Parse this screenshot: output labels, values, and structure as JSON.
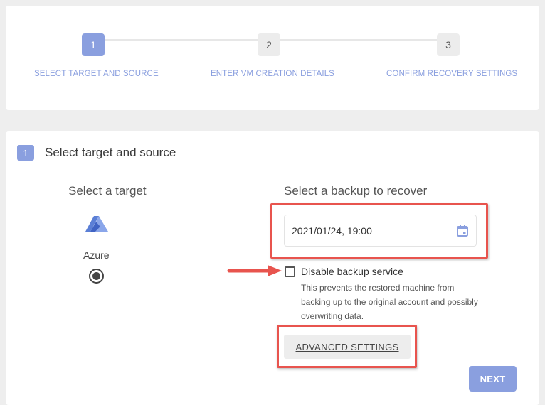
{
  "stepper": {
    "steps": [
      {
        "number": "1",
        "label": "SELECT TARGET AND SOURCE",
        "state": "active"
      },
      {
        "number": "2",
        "label": "ENTER VM CREATION DETAILS",
        "state": "inactive"
      },
      {
        "number": "3",
        "label": "CONFIRM RECOVERY SETTINGS",
        "state": "inactive"
      }
    ]
  },
  "section": {
    "number": "1",
    "title": "Select target and source"
  },
  "target": {
    "heading": "Select a target",
    "option_label": "Azure",
    "icon": "azure-logo-icon",
    "selected": true
  },
  "backup": {
    "heading": "Select a backup to recover",
    "date_value": "2021/01/24, 19:00",
    "icon": "calendar-icon"
  },
  "disable_backup": {
    "label": "Disable backup service",
    "description": "This prevents the restored machine from backing up to the original account and possibly overwriting data.",
    "checked": false
  },
  "buttons": {
    "advanced_label": "ADVANCED SETTINGS",
    "next_label": "NEXT"
  },
  "colors": {
    "accent": "#8a9fdf",
    "highlight": "#e8544e"
  }
}
